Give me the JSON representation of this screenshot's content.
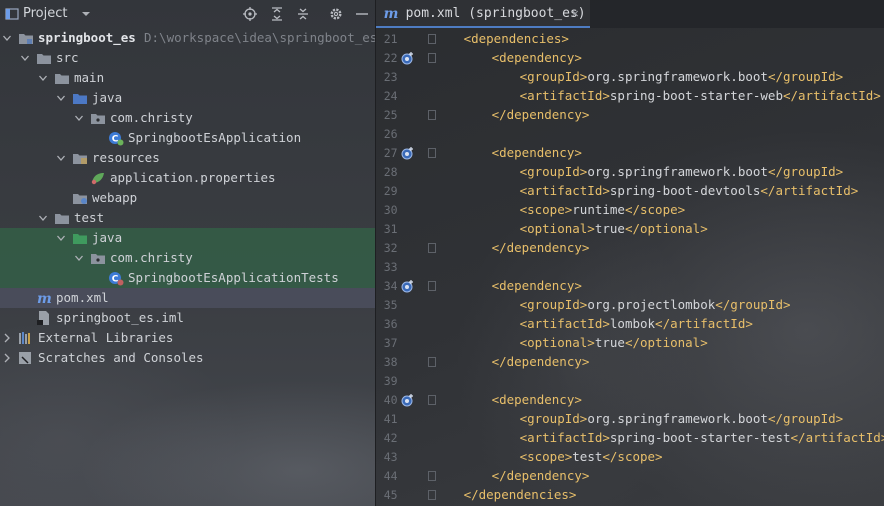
{
  "project_panel": {
    "title": "Project",
    "tree": [
      {
        "label": "springboot_es",
        "hint": "D:\\workspace\\idea\\springboot_es",
        "icon": "module-folder-icon",
        "expanded": true,
        "depth": 0,
        "bold": true
      },
      {
        "label": "src",
        "icon": "folder-icon",
        "expanded": true,
        "depth": 1
      },
      {
        "label": "main",
        "icon": "folder-icon",
        "expanded": true,
        "depth": 2
      },
      {
        "label": "java",
        "icon": "source-folder-icon",
        "expanded": true,
        "depth": 3
      },
      {
        "label": "com.christy",
        "icon": "package-icon",
        "expanded": true,
        "depth": 4
      },
      {
        "label": "SpringbootEsApplication",
        "icon": "spring-boot-class-icon",
        "depth": 5
      },
      {
        "label": "resources",
        "icon": "resources-folder-icon",
        "expanded": true,
        "depth": 3
      },
      {
        "label": "application.properties",
        "icon": "spring-properties-icon",
        "depth": 4
      },
      {
        "label": "webapp",
        "icon": "web-folder-icon",
        "depth": 3
      },
      {
        "label": "test",
        "icon": "folder-icon",
        "expanded": true,
        "depth": 2
      },
      {
        "label": "java",
        "icon": "test-source-folder-icon",
        "expanded": true,
        "depth": 3,
        "highlight": "test"
      },
      {
        "label": "com.christy",
        "icon": "package-icon",
        "expanded": true,
        "depth": 4,
        "highlight": "test"
      },
      {
        "label": "SpringbootEsApplicationTests",
        "icon": "test-class-icon",
        "depth": 5,
        "highlight": "test"
      },
      {
        "label": "pom.xml",
        "icon": "maven-icon",
        "depth": 1,
        "highlight": "file"
      },
      {
        "label": "springboot_es.iml",
        "icon": "iml-file-icon",
        "depth": 1
      },
      {
        "label": "External Libraries",
        "icon": "libraries-icon",
        "expanded": false,
        "depth": 0
      },
      {
        "label": "Scratches and Consoles",
        "icon": "scratches-icon",
        "expanded": false,
        "depth": 0
      }
    ]
  },
  "editor": {
    "tab": {
      "label": "pom.xml (springboot_es)",
      "icon": "maven-icon"
    },
    "lines": [
      {
        "n": "21",
        "indent": 2,
        "parts": [
          [
            "tag",
            "<dependencies>"
          ]
        ]
      },
      {
        "n": "22",
        "indent": 3,
        "gutter": true,
        "parts": [
          [
            "tag",
            "<dependency>"
          ]
        ]
      },
      {
        "n": "23",
        "indent": 4,
        "parts": [
          [
            "tag",
            "<groupId>"
          ],
          [
            "val",
            "org.springframework.boot"
          ],
          [
            "tag",
            "</groupId>"
          ]
        ]
      },
      {
        "n": "24",
        "indent": 4,
        "parts": [
          [
            "tag",
            "<artifactId>"
          ],
          [
            "val",
            "spring-boot-starter-web"
          ],
          [
            "tag",
            "</artifactId>"
          ]
        ]
      },
      {
        "n": "25",
        "indent": 3,
        "parts": [
          [
            "tag",
            "</dependency>"
          ]
        ]
      },
      {
        "n": "26",
        "indent": 0,
        "parts": []
      },
      {
        "n": "27",
        "indent": 3,
        "gutter": true,
        "parts": [
          [
            "tag",
            "<dependency>"
          ]
        ]
      },
      {
        "n": "28",
        "indent": 4,
        "parts": [
          [
            "tag",
            "<groupId>"
          ],
          [
            "val",
            "org.springframework.boot"
          ],
          [
            "tag",
            "</groupId>"
          ]
        ]
      },
      {
        "n": "29",
        "indent": 4,
        "parts": [
          [
            "tag",
            "<artifactId>"
          ],
          [
            "val",
            "spring-boot-devtools"
          ],
          [
            "tag",
            "</artifactId>"
          ]
        ]
      },
      {
        "n": "30",
        "indent": 4,
        "parts": [
          [
            "tag",
            "<scope>"
          ],
          [
            "val",
            "runtime"
          ],
          [
            "tag",
            "</scope>"
          ]
        ]
      },
      {
        "n": "31",
        "indent": 4,
        "parts": [
          [
            "tag",
            "<optional>"
          ],
          [
            "val",
            "true"
          ],
          [
            "tag",
            "</optional>"
          ]
        ]
      },
      {
        "n": "32",
        "indent": 3,
        "parts": [
          [
            "tag",
            "</dependency>"
          ]
        ]
      },
      {
        "n": "33",
        "indent": 0,
        "parts": []
      },
      {
        "n": "34",
        "indent": 3,
        "gutter": true,
        "parts": [
          [
            "tag",
            "<dependency>"
          ]
        ]
      },
      {
        "n": "35",
        "indent": 4,
        "parts": [
          [
            "tag",
            "<groupId>"
          ],
          [
            "val",
            "org.projectlombok"
          ],
          [
            "tag",
            "</groupId>"
          ]
        ]
      },
      {
        "n": "36",
        "indent": 4,
        "parts": [
          [
            "tag",
            "<artifactId>"
          ],
          [
            "val",
            "lombok"
          ],
          [
            "tag",
            "</artifactId>"
          ]
        ]
      },
      {
        "n": "37",
        "indent": 4,
        "parts": [
          [
            "tag",
            "<optional>"
          ],
          [
            "val",
            "true"
          ],
          [
            "tag",
            "</optional>"
          ]
        ]
      },
      {
        "n": "38",
        "indent": 3,
        "parts": [
          [
            "tag",
            "</dependency>"
          ]
        ]
      },
      {
        "n": "39",
        "indent": 0,
        "parts": []
      },
      {
        "n": "40",
        "indent": 3,
        "gutter": true,
        "parts": [
          [
            "tag",
            "<dependency>"
          ]
        ]
      },
      {
        "n": "41",
        "indent": 4,
        "parts": [
          [
            "tag",
            "<groupId>"
          ],
          [
            "val",
            "org.springframework.boot"
          ],
          [
            "tag",
            "</groupId>"
          ]
        ]
      },
      {
        "n": "42",
        "indent": 4,
        "parts": [
          [
            "tag",
            "<artifactId>"
          ],
          [
            "val",
            "spring-boot-starter-test"
          ],
          [
            "tag",
            "</artifactId>"
          ]
        ]
      },
      {
        "n": "43",
        "indent": 4,
        "parts": [
          [
            "tag",
            "<scope>"
          ],
          [
            "val",
            "test"
          ],
          [
            "tag",
            "</scope>"
          ]
        ]
      },
      {
        "n": "44",
        "indent": 3,
        "parts": [
          [
            "tag",
            "</dependency>"
          ]
        ]
      },
      {
        "n": "45",
        "indent": 2,
        "parts": [
          [
            "tag",
            "</dependencies>"
          ]
        ]
      }
    ]
  },
  "colors": {
    "tag": "#e8bf6a",
    "text": "#d4d6da",
    "accent": "#4e7cc2",
    "test_highlight": "#345e46"
  }
}
